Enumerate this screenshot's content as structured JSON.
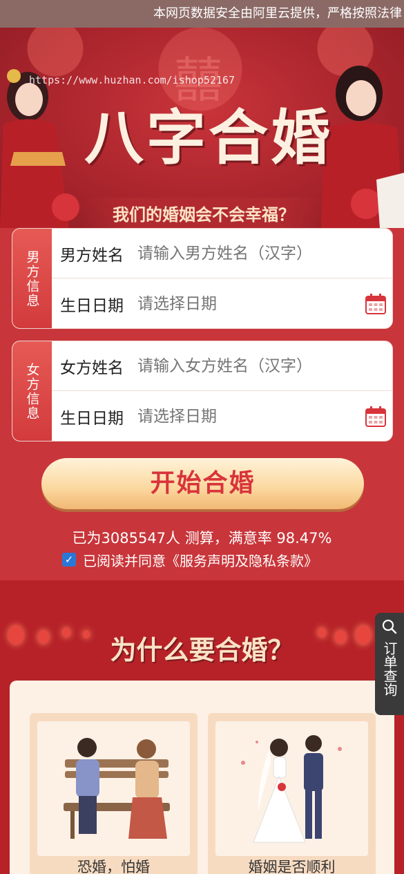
{
  "notice": {
    "text": "本网页数据安全由阿里云提供，严格按照法律"
  },
  "banner": {
    "watermark": "https://www.huzhan.com/ishop52167",
    "title": "八字合婚",
    "subtitle": "我们的婚姻会不会幸福？",
    "xi_glyph": "囍"
  },
  "male": {
    "side_label": "男方信息",
    "name_label": "男方姓名",
    "name_placeholder": "请输入男方姓名（汉字）",
    "birth_label": "生日日期",
    "birth_placeholder": "请选择日期"
  },
  "female": {
    "side_label": "女方信息",
    "name_label": "女方姓名",
    "name_placeholder": "请输入女方姓名（汉字）",
    "birth_label": "生日日期",
    "birth_placeholder": "请选择日期"
  },
  "start_button": "开始合婚",
  "stats": "已为3085547人 测算，满意率 98.47%",
  "agreement": {
    "checked": true,
    "text": "已阅读并同意《服务声明及隐私条款》",
    "check_glyph": "✓"
  },
  "why": {
    "title": "为什么要合婚？",
    "cards": [
      {
        "caption": "恐婚，怕婚"
      },
      {
        "caption": "婚姻是否顺利"
      }
    ]
  },
  "order_query": {
    "label": "订单查询"
  },
  "colors": {
    "primary": "#c8353a",
    "gold": "#fbd79e",
    "accent_text": "#d8343b"
  }
}
